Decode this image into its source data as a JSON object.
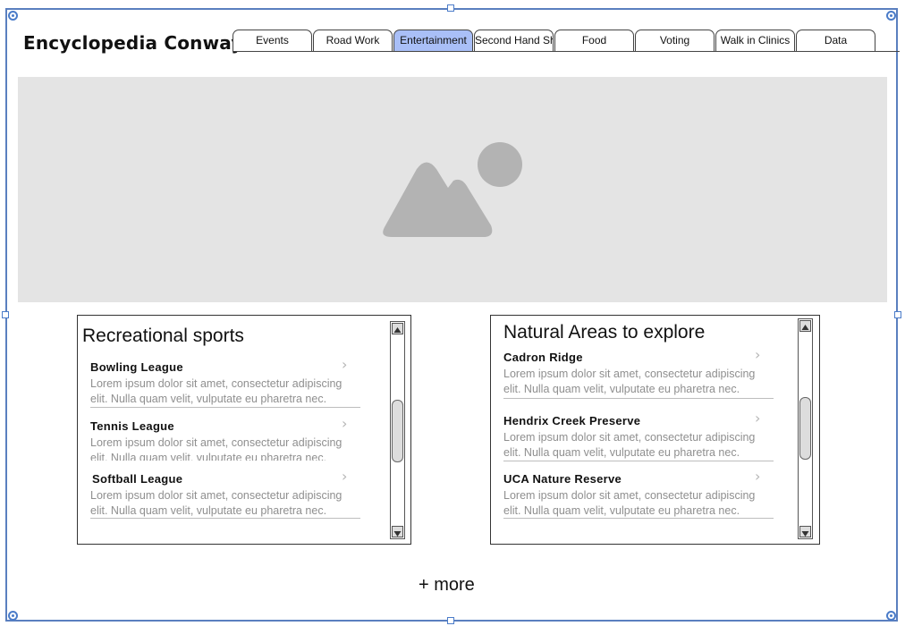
{
  "site": {
    "title": "Encyclopedia Conway"
  },
  "tabs": [
    {
      "label": "Events"
    },
    {
      "label": "Road Work"
    },
    {
      "label": "Entertainment",
      "active": true
    },
    {
      "label": "Second Hand Shops"
    },
    {
      "label": "Food"
    },
    {
      "label": "Voting"
    },
    {
      "label": "Walk in Clinics"
    },
    {
      "label": "Data"
    }
  ],
  "hero": {
    "icon": "image-placeholder-icon"
  },
  "recreational": {
    "title": "Recreational sports",
    "items": [
      {
        "title": "Bowling League",
        "desc": "Lorem ipsum dolor sit amet, consectetur adipiscing elit. Nulla quam velit, vulputate eu pharetra nec."
      },
      {
        "title": "Tennis League",
        "desc": "Lorem ipsum dolor sit amet, consectetur adipiscing elit. Nulla quam velit, vulputate eu pharetra nec."
      },
      {
        "title": "Softball League",
        "desc": "Lorem ipsum dolor sit amet, consectetur adipiscing elit. Nulla quam velit, vulputate eu pharetra nec."
      }
    ]
  },
  "natural": {
    "title": "Natural Areas to explore",
    "items": [
      {
        "title": "Cadron Ridge",
        "desc": "Lorem ipsum dolor sit amet, consectetur adipiscing elit. Nulla quam velit, vulputate eu pharetra nec."
      },
      {
        "title": "Hendrix Creek Preserve",
        "desc": "Lorem ipsum dolor sit amet, consectetur adipiscing elit. Nulla quam velit, vulputate eu pharetra nec."
      },
      {
        "title": "UCA Nature Reserve",
        "desc": "Lorem ipsum dolor sit amet, consectetur adipiscing elit. Nulla quam velit, vulputate eu pharetra nec."
      }
    ]
  },
  "more": {
    "label": "+ more"
  },
  "colors": {
    "active_tab": "#a9bff7",
    "selection": "#4b7cc9",
    "hero_bg": "#e4e4e4",
    "placeholder_icon": "#b3b3b3"
  }
}
